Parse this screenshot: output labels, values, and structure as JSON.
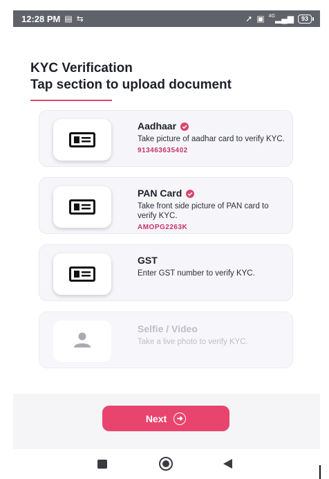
{
  "status_bar": {
    "time": "12:28 PM",
    "network": "4G",
    "battery": "93"
  },
  "header": {
    "title": "KYC Verification",
    "subtitle": "Tap section to upload document",
    "accent_color": "#d9466b"
  },
  "cards": [
    {
      "title": "Aadhaar",
      "description": "Take picture of aadhar card to verify KYC.",
      "value": "913463635402",
      "verified": true,
      "icon": "id-card-icon",
      "enabled": true
    },
    {
      "title": "PAN Card",
      "description": "Take front side picture of PAN card to verify KYC.",
      "value": "AMOPG2263K",
      "verified": true,
      "icon": "id-card-icon",
      "enabled": true
    },
    {
      "title": "GST",
      "description": "Enter GST number to verify KYC.",
      "value": "",
      "verified": false,
      "icon": "id-card-icon",
      "enabled": true
    },
    {
      "title": "Selfie / Video",
      "description": "Take a live photo to verify KYC.",
      "value": "",
      "verified": false,
      "icon": "person-icon",
      "enabled": false
    }
  ],
  "footer": {
    "next_label": "Next",
    "button_color": "#e8456e"
  },
  "colors": {
    "value_text": "#c7346a",
    "card_background": "#f6f6fa"
  }
}
